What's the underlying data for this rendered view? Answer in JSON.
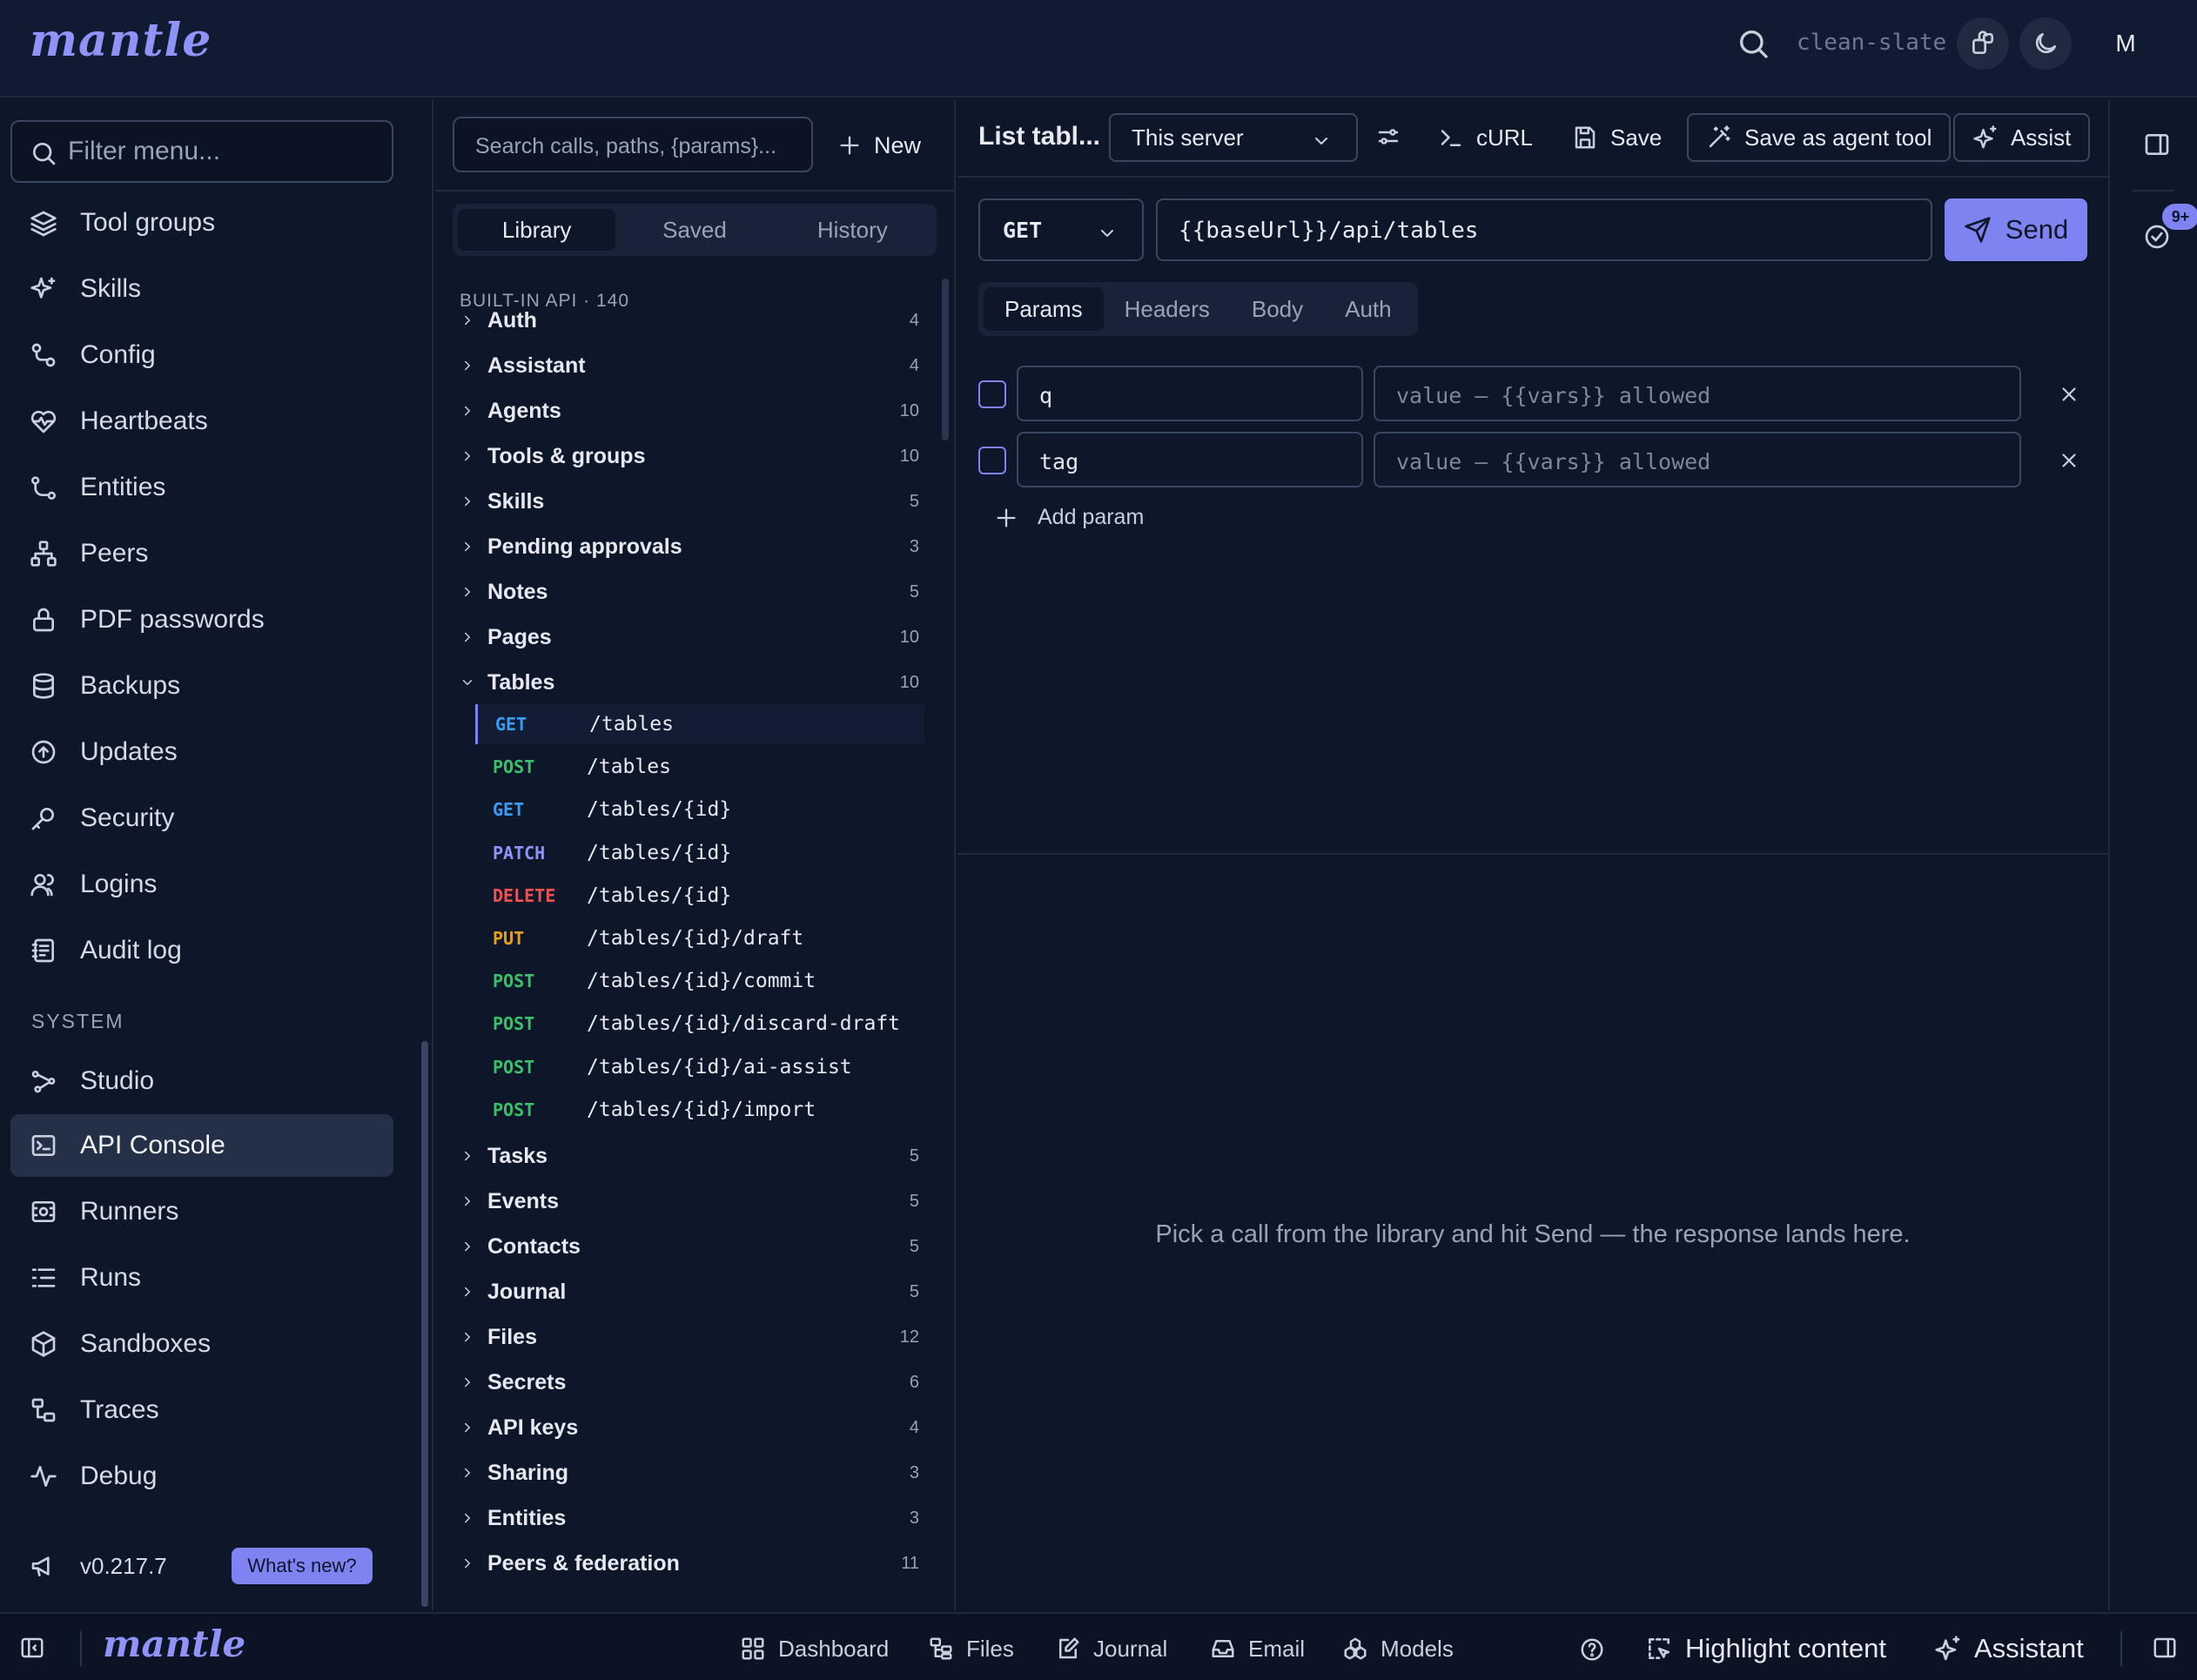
{
  "app": {
    "logo": "mantle",
    "workspace": "clean-slate",
    "avatar_initial": "M"
  },
  "sidebar": {
    "filter_placeholder": "Filter menu...",
    "items": [
      {
        "label": "Tool groups",
        "icon": "layers-icon"
      },
      {
        "label": "Skills",
        "icon": "sparkles-icon"
      },
      {
        "label": "Config",
        "icon": "config-icon"
      },
      {
        "label": "Heartbeats",
        "icon": "heart-pulse-icon"
      },
      {
        "label": "Entities",
        "icon": "entities-icon"
      },
      {
        "label": "Peers",
        "icon": "network-icon"
      },
      {
        "label": "PDF passwords",
        "icon": "lock-icon"
      },
      {
        "label": "Backups",
        "icon": "database-icon"
      },
      {
        "label": "Updates",
        "icon": "arrow-up-circle-icon"
      },
      {
        "label": "Security",
        "icon": "key-icon"
      },
      {
        "label": "Logins",
        "icon": "users-icon"
      },
      {
        "label": "Audit log",
        "icon": "audit-log-icon"
      }
    ],
    "system_label": "SYSTEM",
    "system_items": [
      {
        "label": "Studio",
        "icon": "studio-icon"
      },
      {
        "label": "API Console",
        "icon": "terminal-icon",
        "active": true
      },
      {
        "label": "Runners",
        "icon": "runners-icon"
      },
      {
        "label": "Runs",
        "icon": "list-icon"
      },
      {
        "label": "Sandboxes",
        "icon": "box-icon"
      },
      {
        "label": "Traces",
        "icon": "traces-icon"
      },
      {
        "label": "Debug",
        "icon": "activity-icon"
      }
    ],
    "version": "v0.217.7",
    "whats_new": "What's new?"
  },
  "library": {
    "search_placeholder": "Search calls, paths, {params}...",
    "new_label": "New",
    "tabs": [
      {
        "label": "Library",
        "active": true
      },
      {
        "label": "Saved"
      },
      {
        "label": "History"
      }
    ],
    "section_label": "BUILT-IN API · 140",
    "groups": [
      {
        "name": "Auth",
        "count": "4"
      },
      {
        "name": "Assistant",
        "count": "4"
      },
      {
        "name": "Agents",
        "count": "10"
      },
      {
        "name": "Tools & groups",
        "count": "10"
      },
      {
        "name": "Skills",
        "count": "5"
      },
      {
        "name": "Pending approvals",
        "count": "3"
      },
      {
        "name": "Notes",
        "count": "5"
      },
      {
        "name": "Pages",
        "count": "10"
      },
      {
        "name": "Tables",
        "count": "10",
        "expanded": true
      }
    ],
    "endpoints": [
      {
        "method": "GET",
        "path": "/tables",
        "selected": true
      },
      {
        "method": "POST",
        "path": "/tables"
      },
      {
        "method": "GET",
        "path": "/tables/{id}"
      },
      {
        "method": "PATCH",
        "path": "/tables/{id}"
      },
      {
        "method": "DELETE",
        "path": "/tables/{id}"
      },
      {
        "method": "PUT",
        "path": "/tables/{id}/draft"
      },
      {
        "method": "POST",
        "path": "/tables/{id}/commit"
      },
      {
        "method": "POST",
        "path": "/tables/{id}/discard-draft"
      },
      {
        "method": "POST",
        "path": "/tables/{id}/ai-assist"
      },
      {
        "method": "POST",
        "path": "/tables/{id}/import"
      }
    ],
    "groups_after": [
      {
        "name": "Tasks",
        "count": "5"
      },
      {
        "name": "Events",
        "count": "5"
      },
      {
        "name": "Contacts",
        "count": "5"
      },
      {
        "name": "Journal",
        "count": "5"
      },
      {
        "name": "Files",
        "count": "12"
      },
      {
        "name": "Secrets",
        "count": "6"
      },
      {
        "name": "API keys",
        "count": "4"
      },
      {
        "name": "Sharing",
        "count": "3"
      },
      {
        "name": "Entities",
        "count": "3"
      },
      {
        "name": "Peers & federation",
        "count": "11"
      }
    ],
    "method_colors": {
      "GET": "#3b9cf5",
      "POST": "#38c06a",
      "PATCH": "#8f93f7",
      "DELETE": "#f05252",
      "PUT": "#e5a11a"
    }
  },
  "request": {
    "title": "List tabl...",
    "server": "This server",
    "toolbar": {
      "curl": "cURL",
      "save": "Save",
      "save_agent": "Save as agent tool",
      "assist": "Assist"
    },
    "method": "GET",
    "url": "{{baseUrl}}/api/tables",
    "send": "Send",
    "tabs": [
      {
        "label": "Params",
        "active": true
      },
      {
        "label": "Headers"
      },
      {
        "label": "Body"
      },
      {
        "label": "Auth"
      }
    ],
    "params": [
      {
        "key": "q",
        "value_placeholder": "value — {{vars}} allowed"
      },
      {
        "key": "tag",
        "value_placeholder": "value — {{vars}} allowed"
      }
    ],
    "add_param": "Add param"
  },
  "response": {
    "empty": "Pick a call from the library and hit Send — the response lands here."
  },
  "rightrail": {
    "badge": "9+"
  },
  "statusbar": {
    "logo": "mantle",
    "links": [
      {
        "label": "Dashboard",
        "icon": "dashboard-icon"
      },
      {
        "label": "Files",
        "icon": "files-icon"
      },
      {
        "label": "Journal",
        "icon": "journal-icon"
      },
      {
        "label": "Email",
        "icon": "inbox-icon"
      },
      {
        "label": "Models",
        "icon": "models-icon"
      }
    ],
    "highlight": "Highlight content",
    "assistant": "Assistant"
  },
  "colors": {
    "accent": "#7f83f2",
    "background": "#0e1629",
    "panel": "#182238",
    "border": "#3a4660"
  }
}
